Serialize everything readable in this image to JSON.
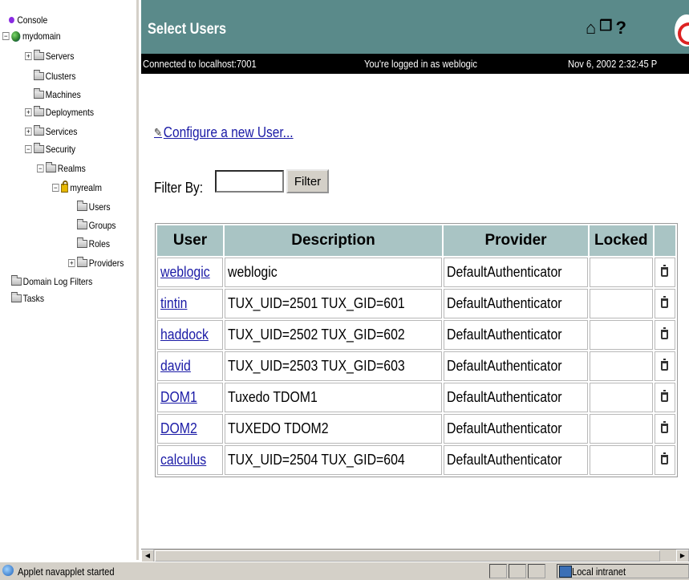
{
  "nav": {
    "items": [
      {
        "label": "Console",
        "icon": "console-dot-icon"
      },
      {
        "label": "mydomain",
        "icon": "globe-icon"
      },
      {
        "label": "Servers",
        "icon": "folder-icon"
      },
      {
        "label": "Clusters",
        "icon": "folder-icon"
      },
      {
        "label": "Machines",
        "icon": "folder-icon"
      },
      {
        "label": "Deployments",
        "icon": "folder-icon"
      },
      {
        "label": "Services",
        "icon": "folder-icon"
      },
      {
        "label": "Security",
        "icon": "folder-icon"
      },
      {
        "label": "Realms",
        "icon": "folder-icon"
      },
      {
        "label": "myrealm",
        "icon": "lock-icon"
      },
      {
        "label": "Users",
        "icon": "folder-icon"
      },
      {
        "label": "Groups",
        "icon": "folder-icon"
      },
      {
        "label": "Roles",
        "icon": "folder-icon"
      },
      {
        "label": "Providers",
        "icon": "folder-icon"
      },
      {
        "label": "Domain Log Filters",
        "icon": "folder-icon"
      },
      {
        "label": "Tasks",
        "icon": "folder-icon"
      }
    ]
  },
  "header": {
    "title": "Select Users",
    "icons": [
      "home-icon",
      "window-icon",
      "help-icon"
    ],
    "accent": "#5a8a8a"
  },
  "status": {
    "connection": "Connected to localhost:7001",
    "login": "You're logged in as weblogic",
    "datetime": "Nov 6, 2002 2:32:45 P"
  },
  "configure_link": "Configure a new User...",
  "filter": {
    "label": "Filter By:",
    "value": "",
    "button": "Filter"
  },
  "table": {
    "headers": [
      "User",
      "Description",
      "Provider",
      "Locked"
    ],
    "rows": [
      {
        "user": "weblogic",
        "description": "weblogic",
        "provider": "DefaultAuthenticator",
        "locked": ""
      },
      {
        "user": "tintin",
        "description": "TUX_UID=2501 TUX_GID=601",
        "provider": "DefaultAuthenticator",
        "locked": ""
      },
      {
        "user": "haddock",
        "description": "TUX_UID=2502 TUX_GID=602",
        "provider": "DefaultAuthenticator",
        "locked": ""
      },
      {
        "user": "david",
        "description": "TUX_UID=2503 TUX_GID=603",
        "provider": "DefaultAuthenticator",
        "locked": ""
      },
      {
        "user": "DOM1",
        "description": "Tuxedo TDOM1",
        "provider": "DefaultAuthenticator",
        "locked": ""
      },
      {
        "user": "DOM2",
        "description": "TUXEDO TDOM2",
        "provider": "DefaultAuthenticator",
        "locked": ""
      },
      {
        "user": "calculus",
        "description": "TUX_UID=2504 TUX_GID=604",
        "provider": "DefaultAuthenticator",
        "locked": ""
      }
    ]
  },
  "browser_status": {
    "message": "Applet navapplet started",
    "zone": "Local intranet"
  }
}
